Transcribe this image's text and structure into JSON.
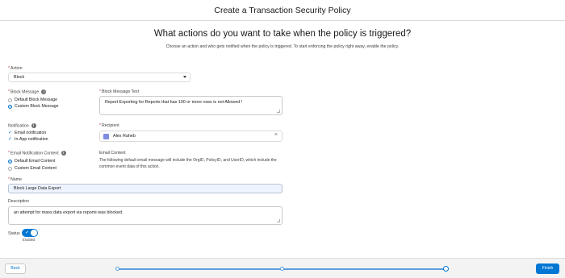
{
  "header": {
    "title": "Create a Transaction Security Policy"
  },
  "hero": {
    "title": "What actions do you want to take when the policy is triggered?",
    "subtitle": "Choose an action and who gets notified when the policy is triggered. To start enforcing the policy right away, enable the policy."
  },
  "action": {
    "label": "Action",
    "value": "Block"
  },
  "block_message": {
    "label": "Block Message",
    "options": [
      "Default Block Message",
      "Custom Block Message"
    ],
    "selected": "Custom Block Message"
  },
  "block_message_text": {
    "label": "Block Message Text",
    "value": "Report Exporting for Reports that has 100 or more rows is not Allowed !"
  },
  "notification": {
    "label": "Notification",
    "options": [
      "Email notification",
      "In-App notification"
    ]
  },
  "recipient": {
    "label": "Recipient",
    "value": "Alex Raheb"
  },
  "email_content": {
    "label": "Email Notification Content",
    "options": [
      "Default Email Content",
      "Custom Email Content"
    ],
    "selected": "Default Email Content",
    "heading": "Email Content",
    "description": "The following default email message will include the OrgID, PolicyID, and UserID, which include the common event data of this action."
  },
  "name": {
    "label": "Name",
    "value": "Block Large Data Export"
  },
  "description": {
    "label": "Description",
    "value": "an attempt for mass data export via reports was blocked."
  },
  "status": {
    "label": "Status",
    "toggle_text": "Enabled",
    "enabled": true
  },
  "footer": {
    "back": "Back",
    "finish": "Finish",
    "progress_steps": 3,
    "current_step": 3
  },
  "colors": {
    "brand": "#0176d3",
    "required": "#c23934"
  }
}
